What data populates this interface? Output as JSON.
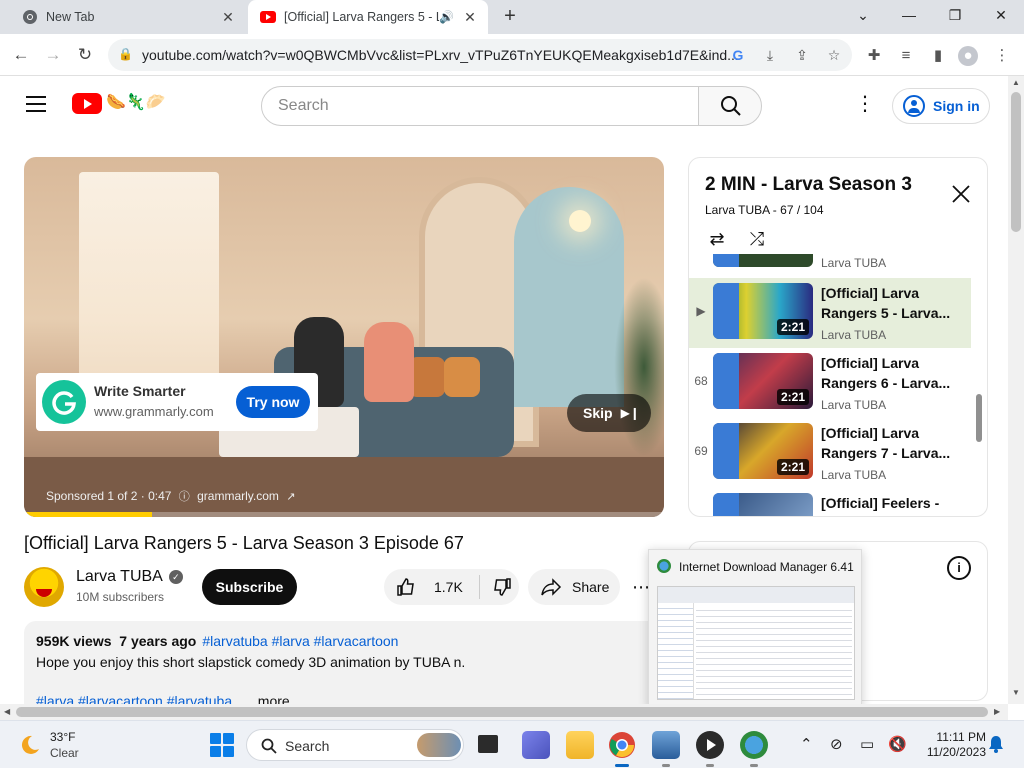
{
  "browser": {
    "tabs": [
      {
        "title": "New Tab",
        "active": false
      },
      {
        "title": "[Official] Larva Rangers 5 - L",
        "active": true
      }
    ],
    "url": "youtube.com/watch?v=w0QBWCMbVvc&list=PLxrv_vTPuZ6TnYEUKQEMeakgxiseb1d7E&ind..."
  },
  "youtube": {
    "search_placeholder": "Search",
    "sign_in": "Sign in"
  },
  "ad": {
    "title": "Write Smarter",
    "url": "www.grammarly.com",
    "cta": "Try now",
    "skip": "Skip",
    "sponsored": "Sponsored 1 of 2 · 0:47",
    "sponsor_domain": "grammarly.com",
    "progress": 0.2
  },
  "video": {
    "title": "[Official] Larva Rangers 5 - Larva Season 3 Episode 67",
    "channel": "Larva TUBA",
    "subscribers": "10M subscribers",
    "subscribe": "Subscribe",
    "likes": "1.7K",
    "share": "Share",
    "views": "959K views",
    "age": "7 years ago",
    "tags": "#larvatuba #larva #larvacartoon",
    "description": "Hope you enjoy this short slapstick comedy 3D animation by TUBA n.",
    "bottom_tags": "#larva #larvacartoon #larvatuba",
    "more": "...more"
  },
  "playlist": {
    "title": "2 MIN - Larva Season 3",
    "subtitle": "Larva TUBA - 67 / 104",
    "prev_channel": "Larva TUBA",
    "items": [
      {
        "index": "▶",
        "title": "[Official] Larva Rangers 5 - Larva...",
        "channel": "Larva TUBA",
        "duration": "2:21",
        "current": true
      },
      {
        "index": "68",
        "title": "[Official] Larva Rangers 6 - Larva...",
        "channel": "Larva TUBA",
        "duration": "2:21",
        "current": false
      },
      {
        "index": "69",
        "title": "[Official] Larva Rangers 7 - Larva...",
        "channel": "Larva TUBA",
        "duration": "2:21",
        "current": false
      },
      {
        "index": "",
        "title": "[Official] Feelers -",
        "channel": "",
        "duration": "",
        "current": false
      }
    ]
  },
  "idm": {
    "title": "Internet Download Manager 6.41"
  },
  "taskbar": {
    "temperature": "33°F",
    "condition": "Clear",
    "search": "Search",
    "time": "11:11 PM",
    "date": "11/20/2023"
  }
}
